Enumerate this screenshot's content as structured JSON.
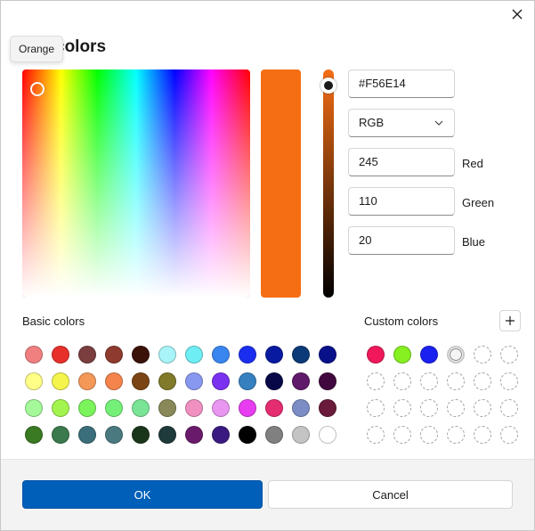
{
  "dialog": {
    "title": "colors",
    "tooltip": "Orange"
  },
  "picker": {
    "hex": "#F56E14",
    "mode": "RGB",
    "red": "245",
    "green": "110",
    "blue": "20",
    "labels": {
      "red": "Red",
      "green": "Green",
      "blue": "Blue"
    },
    "selected_color": "#F56E14",
    "value_level": 0.96
  },
  "basic_colors": {
    "label": "Basic colors",
    "swatches": [
      "#F08080",
      "#E8302A",
      "#7A3E3E",
      "#8E3A2E",
      "#3A1208",
      "#A8F4F8",
      "#6EEEF4",
      "#3A86F0",
      "#1A2EF0",
      "#081AA0",
      "#0C3A78",
      "#08108A",
      "#FFFF88",
      "#F4F44C",
      "#F49858",
      "#F4844C",
      "#7A4414",
      "#807A2A",
      "#8898F0",
      "#7A32F0",
      "#3680C0",
      "#080848",
      "#601A6A",
      "#40083E",
      "#A4F89A",
      "#A4F450",
      "#7AF45A",
      "#74F078",
      "#7AE496",
      "#888858",
      "#F090C0",
      "#E896F0",
      "#E83CF0",
      "#E42C70",
      "#7C8CC4",
      "#6A1A3A",
      "#3A7A22",
      "#3A7A4C",
      "#3A6E7A",
      "#4A7A80",
      "#1A361A",
      "#1E3A3A",
      "#6A1A6A",
      "#3A1A80",
      "#000000",
      "#808080",
      "#C4C4C4",
      "#FFFFFF"
    ]
  },
  "custom_colors": {
    "label": "Custom colors",
    "add_label": "+",
    "filled": [
      "#F0185A",
      "#86F020",
      "#1A20F0"
    ],
    "selected_slot": 3
  },
  "footer": {
    "ok_label": "OK",
    "cancel_label": "Cancel"
  },
  "icons": {
    "close": "close-icon",
    "chevron": "chevron-down-icon",
    "add": "plus-icon"
  }
}
